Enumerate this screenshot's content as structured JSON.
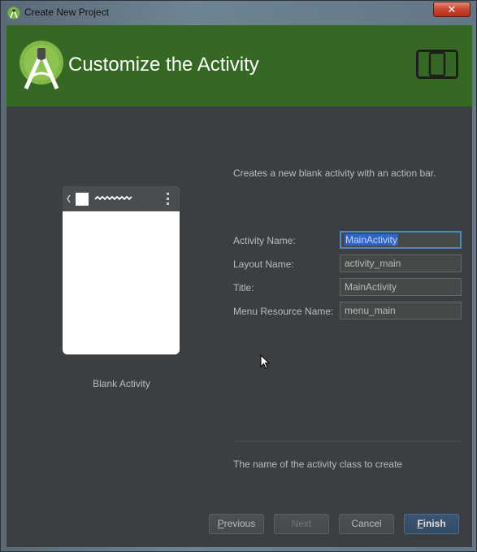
{
  "window": {
    "title": "Create New Project",
    "close_glyph": "✕"
  },
  "header": {
    "title": "Customize the Activity",
    "logo_icon": "android-studio-icon",
    "device_icon": "phone-tablet-icon",
    "color": "#356822"
  },
  "preview": {
    "template_name": "Blank Activity"
  },
  "description": "Creates a new blank activity with an action bar.",
  "fields": [
    {
      "label": "Activity Name:",
      "value": "MainActivity",
      "focused": true
    },
    {
      "label": "Layout Name:",
      "value": "activity_main"
    },
    {
      "label": "Title:",
      "value": "MainActivity"
    },
    {
      "label": "Menu Resource Name:",
      "value": "menu_main"
    }
  ],
  "help_text": "The name of the activity class to create",
  "buttons": {
    "previous_first": "P",
    "previous_rest": "revious",
    "next": "Next",
    "cancel": "Cancel",
    "finish_first": "F",
    "finish_rest": "inish"
  },
  "colors": {
    "background": "#3c3f41",
    "accent": "#4a88c7",
    "selection": "#2f65ca"
  }
}
